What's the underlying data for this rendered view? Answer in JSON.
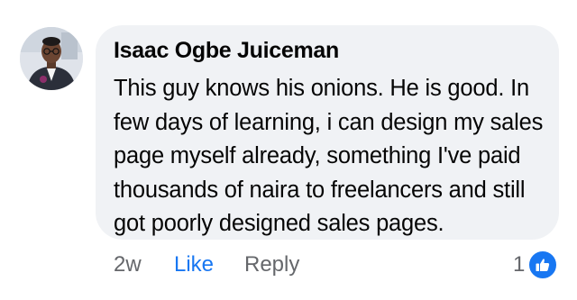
{
  "comment": {
    "author": "Isaac Ogbe Juiceman",
    "text": "This guy knows his onions. He is good. In few days of learning, i can design my sales page myself already, something I've paid thousands of naira to freelancers and still got poorly designed sales pages.",
    "time": "2w",
    "like_label": "Like",
    "reply_label": "Reply",
    "reaction_count": "1",
    "reaction_type": "like-icon"
  },
  "colors": {
    "bubble": "#f0f2f5",
    "accent": "#1877f2",
    "muted": "#65676b",
    "text": "#050505"
  }
}
